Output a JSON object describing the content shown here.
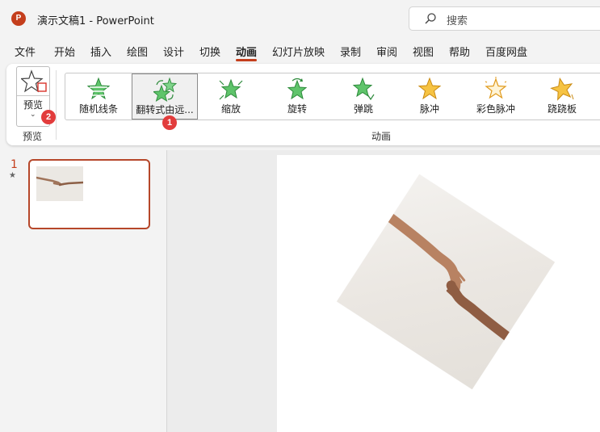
{
  "titlebar": {
    "app_icon_letter": "P",
    "title": "演示文稿1  -  PowerPoint",
    "search_placeholder": "搜索"
  },
  "menu": [
    {
      "label": "文件",
      "active": false
    },
    {
      "label": "开始",
      "active": false
    },
    {
      "label": "插入",
      "active": false
    },
    {
      "label": "绘图",
      "active": false
    },
    {
      "label": "设计",
      "active": false
    },
    {
      "label": "切换",
      "active": false
    },
    {
      "label": "动画",
      "active": true
    },
    {
      "label": "幻灯片放映",
      "active": false
    },
    {
      "label": "录制",
      "active": false
    },
    {
      "label": "审阅",
      "active": false
    },
    {
      "label": "视图",
      "active": false
    },
    {
      "label": "帮助",
      "active": false
    },
    {
      "label": "百度网盘",
      "active": false
    }
  ],
  "ribbon": {
    "preview": {
      "label": "预览",
      "group_label": "预览"
    },
    "animation_group_label": "动画",
    "animations": [
      {
        "label": "随机线条",
        "icon": "random-bars-icon",
        "selected": false
      },
      {
        "label": "翻转式由远...",
        "icon": "flip-icon",
        "selected": true
      },
      {
        "label": "缩放",
        "icon": "zoom-icon",
        "selected": false
      },
      {
        "label": "旋转",
        "icon": "spin-icon",
        "selected": false
      },
      {
        "label": "弹跳",
        "icon": "bounce-icon",
        "selected": false
      },
      {
        "label": "脉冲",
        "icon": "pulse-icon",
        "selected": false
      },
      {
        "label": "彩色脉冲",
        "icon": "color-pulse-icon",
        "selected": false
      },
      {
        "label": "跷跷板",
        "icon": "teeter-icon",
        "selected": false
      }
    ]
  },
  "badges": {
    "flip": "1",
    "preview": "2"
  },
  "slides": [
    {
      "number": "1",
      "has_animation_marker": "★"
    }
  ],
  "colors": {
    "accent": "#c43e1c",
    "badge": "#e23c3c",
    "entrance_green": "#3fa34d",
    "emphasis_gold": "#f2b233"
  }
}
